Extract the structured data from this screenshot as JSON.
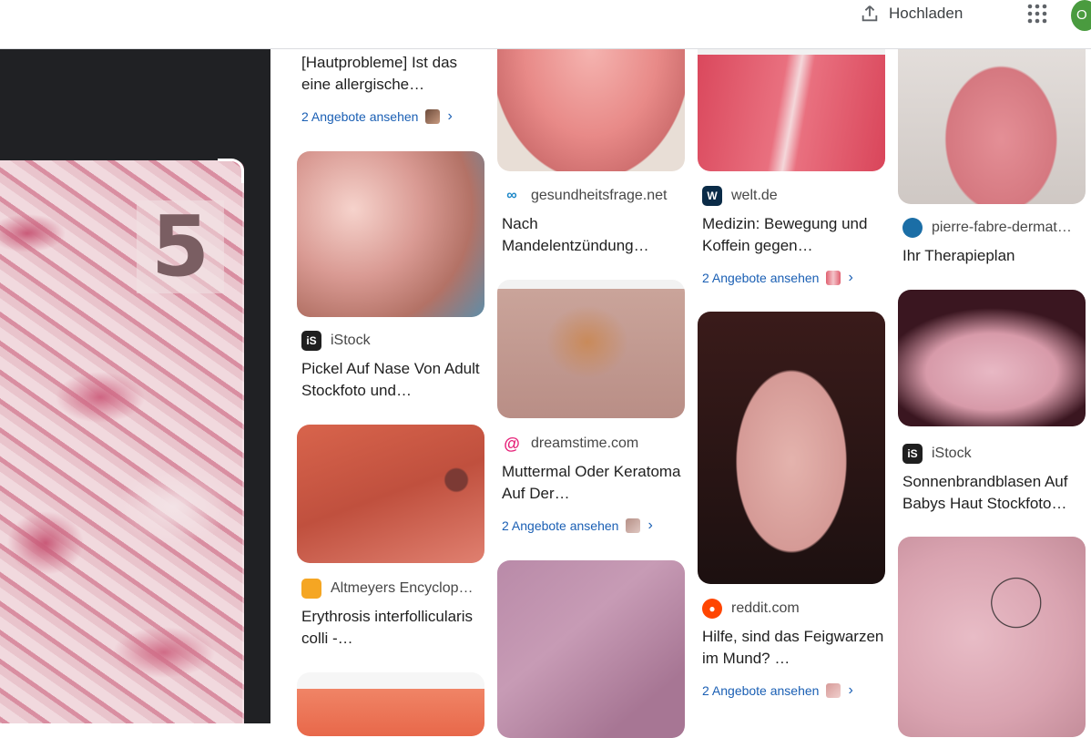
{
  "header": {
    "upload_label": "Hochladen",
    "avatar_initial": "O"
  },
  "viewer": {
    "badge_number": "5"
  },
  "results": {
    "col1": [
      {
        "title": "[Hautprobleme] Ist das eine allergische…",
        "offers": "2 Angebote ansehen"
      },
      {
        "source": "iStock",
        "title": "Pickel Auf Nase Von Adult Stockfoto und…"
      },
      {
        "source": "Altmeyers Encyclop…",
        "title": "Erythrosis interfollicularis colli -…"
      }
    ],
    "col2": [
      {
        "source": "gesundheitsfrage.net",
        "title": "Nach Mandelentzündung…"
      },
      {
        "source": "dreamstime.com",
        "title": "Muttermal Oder Keratoma Auf Der…",
        "offers": "2 Angebote ansehen"
      }
    ],
    "col3": [
      {
        "source": "welt.de",
        "title": "Medizin: Bewegung und Koffein gegen…",
        "offers": "2 Angebote ansehen"
      },
      {
        "source": "reddit.com",
        "title": "Hilfe, sind das Feigwarzen im Mund? …",
        "offers": "2 Angebote ansehen"
      }
    ],
    "col4": [
      {
        "source": "pierre-fabre-dermat…",
        "title": "Ihr Therapieplan"
      },
      {
        "source": "iStock",
        "title": "Sonnenbrandblasen Auf Babys Haut Stockfoto…"
      }
    ]
  },
  "colors": {
    "link": "#1a5fb4",
    "viewer_bg": "#202124"
  }
}
